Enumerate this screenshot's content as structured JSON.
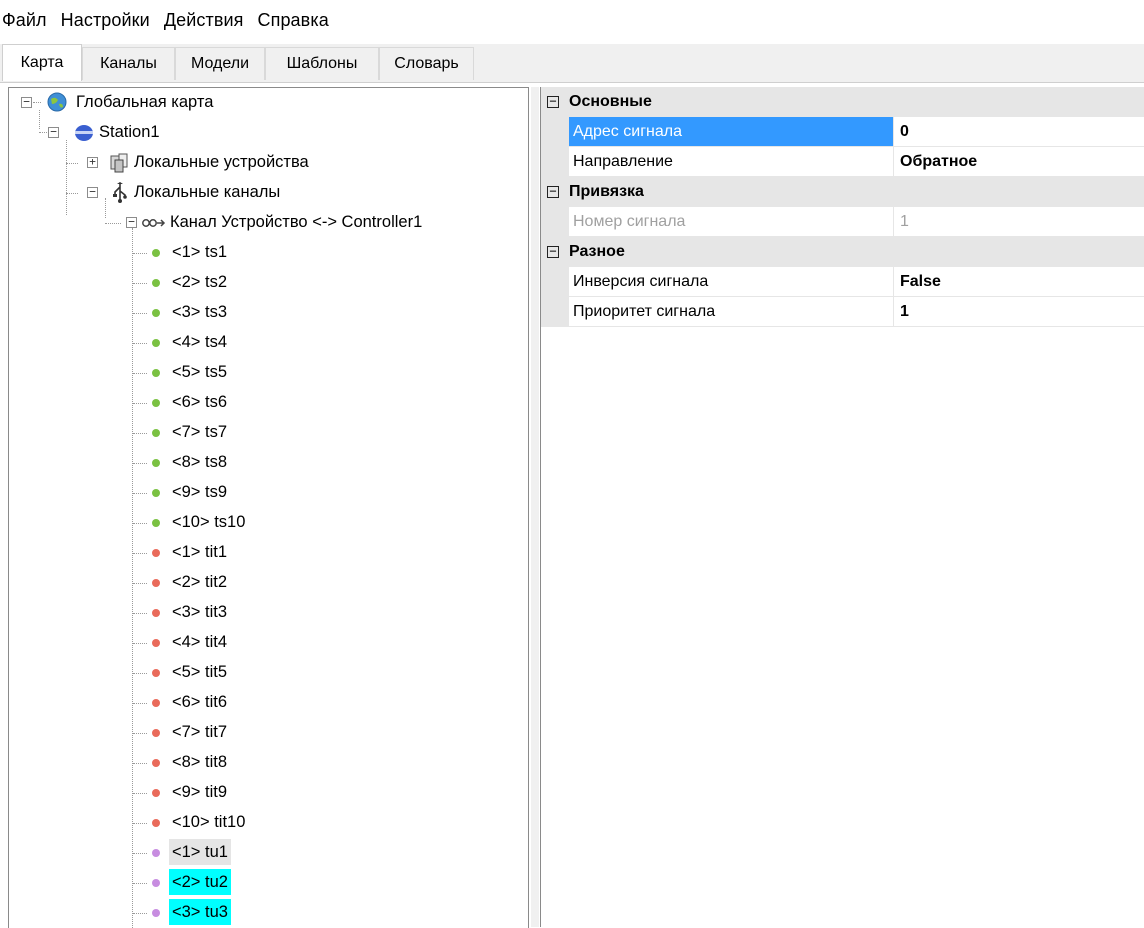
{
  "menu": [
    "Файл",
    "Настройки",
    "Действия",
    "Справка"
  ],
  "tabs": [
    {
      "label": "Карта",
      "active": true
    },
    {
      "label": "Каналы",
      "active": false
    },
    {
      "label": "Модели",
      "active": false
    },
    {
      "label": "Шаблоны",
      "active": false
    },
    {
      "label": "Словарь",
      "active": false
    }
  ],
  "tree": {
    "root": "Глобальная карта",
    "station": "Station1",
    "local_devices": "Локальные устройства",
    "local_channels": "Локальные каналы",
    "channel": "Канал Устройство <-> Controller1",
    "signals": [
      {
        "label": "<1> ts1",
        "type": "green"
      },
      {
        "label": "<2> ts2",
        "type": "green"
      },
      {
        "label": "<3> ts3",
        "type": "green"
      },
      {
        "label": "<4> ts4",
        "type": "green"
      },
      {
        "label": "<5> ts5",
        "type": "green"
      },
      {
        "label": "<6> ts6",
        "type": "green"
      },
      {
        "label": "<7> ts7",
        "type": "green"
      },
      {
        "label": "<8> ts8",
        "type": "green"
      },
      {
        "label": "<9> ts9",
        "type": "green"
      },
      {
        "label": "<10> ts10",
        "type": "green"
      },
      {
        "label": "<1> tit1",
        "type": "red"
      },
      {
        "label": "<2> tit2",
        "type": "red"
      },
      {
        "label": "<3> tit3",
        "type": "red"
      },
      {
        "label": "<4> tit4",
        "type": "red"
      },
      {
        "label": "<5> tit5",
        "type": "red"
      },
      {
        "label": "<6> tit6",
        "type": "red"
      },
      {
        "label": "<7> tit7",
        "type": "red"
      },
      {
        "label": "<8> tit8",
        "type": "red"
      },
      {
        "label": "<9> tit9",
        "type": "red"
      },
      {
        "label": "<10> tit10",
        "type": "red"
      },
      {
        "label": "<1> tu1",
        "type": "purple",
        "highlight": "gray"
      },
      {
        "label": "<2> tu2",
        "type": "purple",
        "highlight": "cyan"
      },
      {
        "label": "<3> tu3",
        "type": "purple",
        "highlight": "cyan"
      }
    ]
  },
  "properties": [
    {
      "category": "Основные",
      "items": [
        {
          "name": "Адрес сигнала",
          "value": "0",
          "selected": true,
          "bold": true
        },
        {
          "name": "Направление",
          "value": "Обратное",
          "bold": true
        }
      ]
    },
    {
      "category": "Привязка",
      "items": [
        {
          "name": "Номер сигнала",
          "value": "1",
          "disabled": true
        }
      ]
    },
    {
      "category": "Разное",
      "items": [
        {
          "name": "Инверсия сигнала",
          "value": "False",
          "bold": true
        },
        {
          "name": "Приоритет сигнала",
          "value": "1",
          "bold": true
        }
      ]
    }
  ],
  "colors": {
    "selection": "#3399ff",
    "highlight_cyan": "#00ffff",
    "dot_green": "#7ac142",
    "dot_red": "#e96a5a",
    "dot_purple": "#c78ce0"
  }
}
